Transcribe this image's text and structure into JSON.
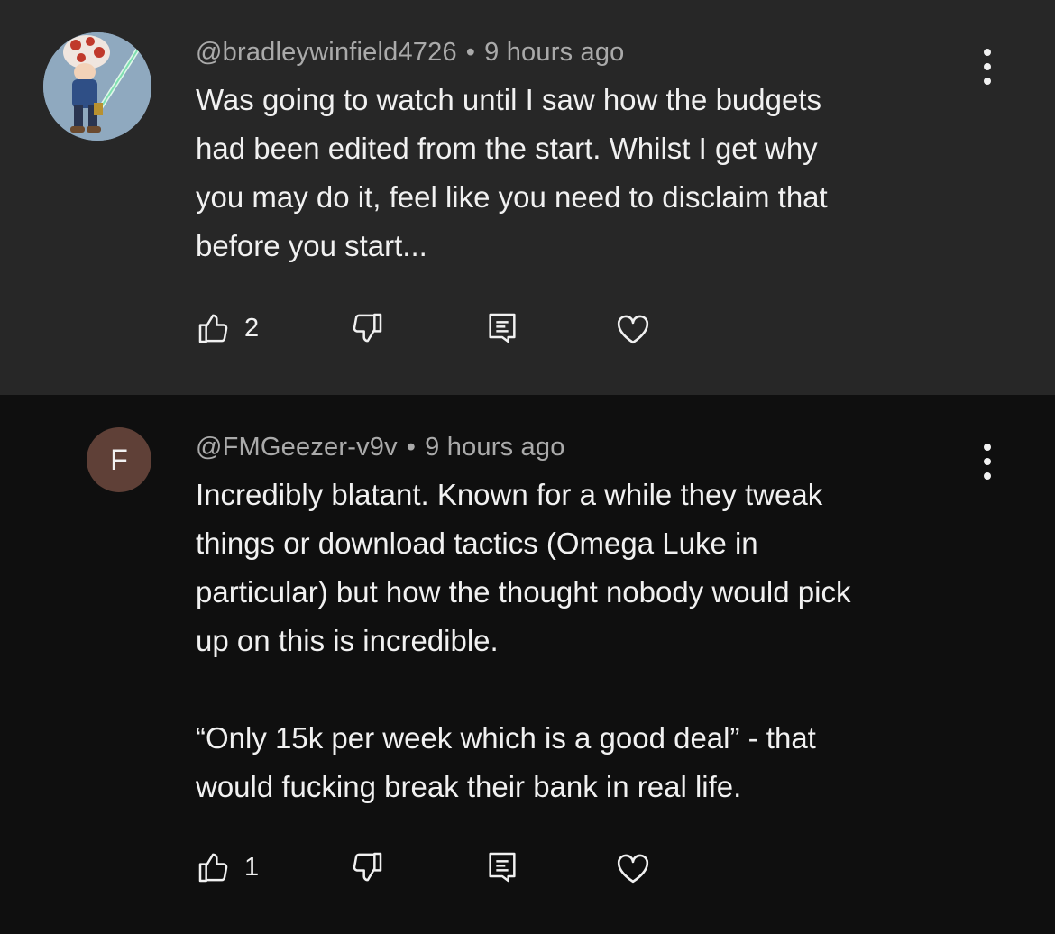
{
  "comments": [
    {
      "author": "@bradleywinfield4726",
      "separator": "•",
      "time": "9 hours ago",
      "text": "Was going to watch until I saw how the budgets\nhad been edited from the start. Whilst I get why\nyou may do it, feel like you need to disclaim that\nbefore you start...",
      "likes": "2",
      "avatar": {
        "type": "image",
        "icon": "toad-lightsaber-avatar"
      }
    },
    {
      "author": "@FMGeezer-v9v",
      "separator": "•",
      "time": "9 hours ago",
      "text": "Incredibly blatant. Known for a while they tweak\nthings or download tactics (Omega Luke in\nparticular) but how the thought nobody would pick\nup on this is incredible.\n\n“Only 15k per week which is a good deal” - that\nwould fucking break their bank in real life.",
      "likes": "1",
      "avatar": {
        "type": "letter",
        "letter": "F",
        "color": "#5f4037"
      }
    }
  ],
  "icons": [
    "thumbs-up-icon",
    "thumbs-down-icon",
    "reply-icon",
    "heart-icon",
    "more-vert-icon"
  ]
}
